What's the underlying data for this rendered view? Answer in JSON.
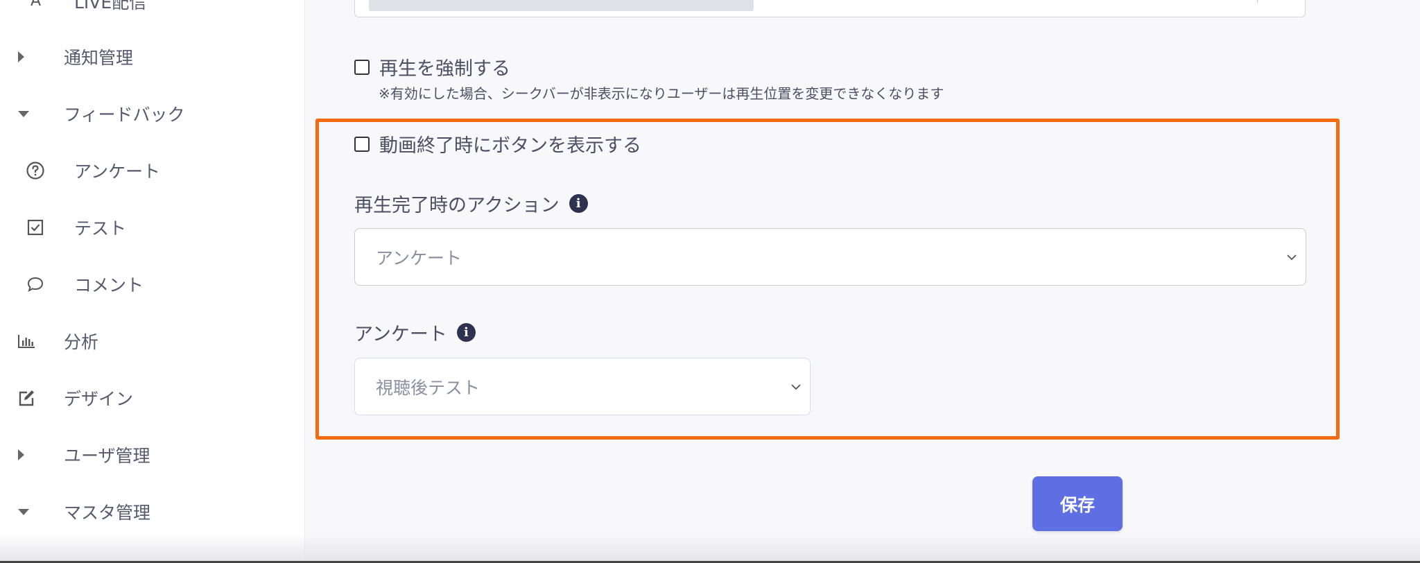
{
  "sidebar": {
    "items": [
      {
        "label": "LIVE配信",
        "icon": "live-icon",
        "type": "top"
      },
      {
        "label": "通知管理",
        "caret": "right",
        "type": "group"
      },
      {
        "label": "フィードバック",
        "caret": "down",
        "type": "group"
      },
      {
        "label": "アンケート",
        "icon": "question-circle-icon",
        "type": "sub"
      },
      {
        "label": "テスト",
        "icon": "checkbox-icon",
        "type": "sub"
      },
      {
        "label": "コメント",
        "icon": "comment-icon",
        "type": "sub"
      },
      {
        "label": "分析",
        "icon": "bar-chart-icon",
        "type": "top"
      },
      {
        "label": "デザイン",
        "icon": "edit-icon",
        "type": "top"
      },
      {
        "label": "ユーザ管理",
        "caret": "right",
        "type": "group"
      },
      {
        "label": "マスタ管理",
        "caret": "down",
        "type": "group"
      }
    ]
  },
  "form": {
    "force_playback": {
      "label": "再生を強制する",
      "checked": false,
      "note": "※有効にした場合、シークバーが非表示になりユーザーは再生位置を変更できなくなります"
    },
    "show_button_on_end": {
      "label": "動画終了時にボタンを表示する",
      "checked": false
    },
    "completion_action": {
      "label": "再生完了時のアクション",
      "value": "アンケート"
    },
    "survey": {
      "label": "アンケート",
      "value": "視聴後テスト"
    },
    "save_label": "保存"
  },
  "colors": {
    "highlight_border": "#f26b12",
    "save_button": "#5d6fe2",
    "info_icon": "#2e3150"
  }
}
